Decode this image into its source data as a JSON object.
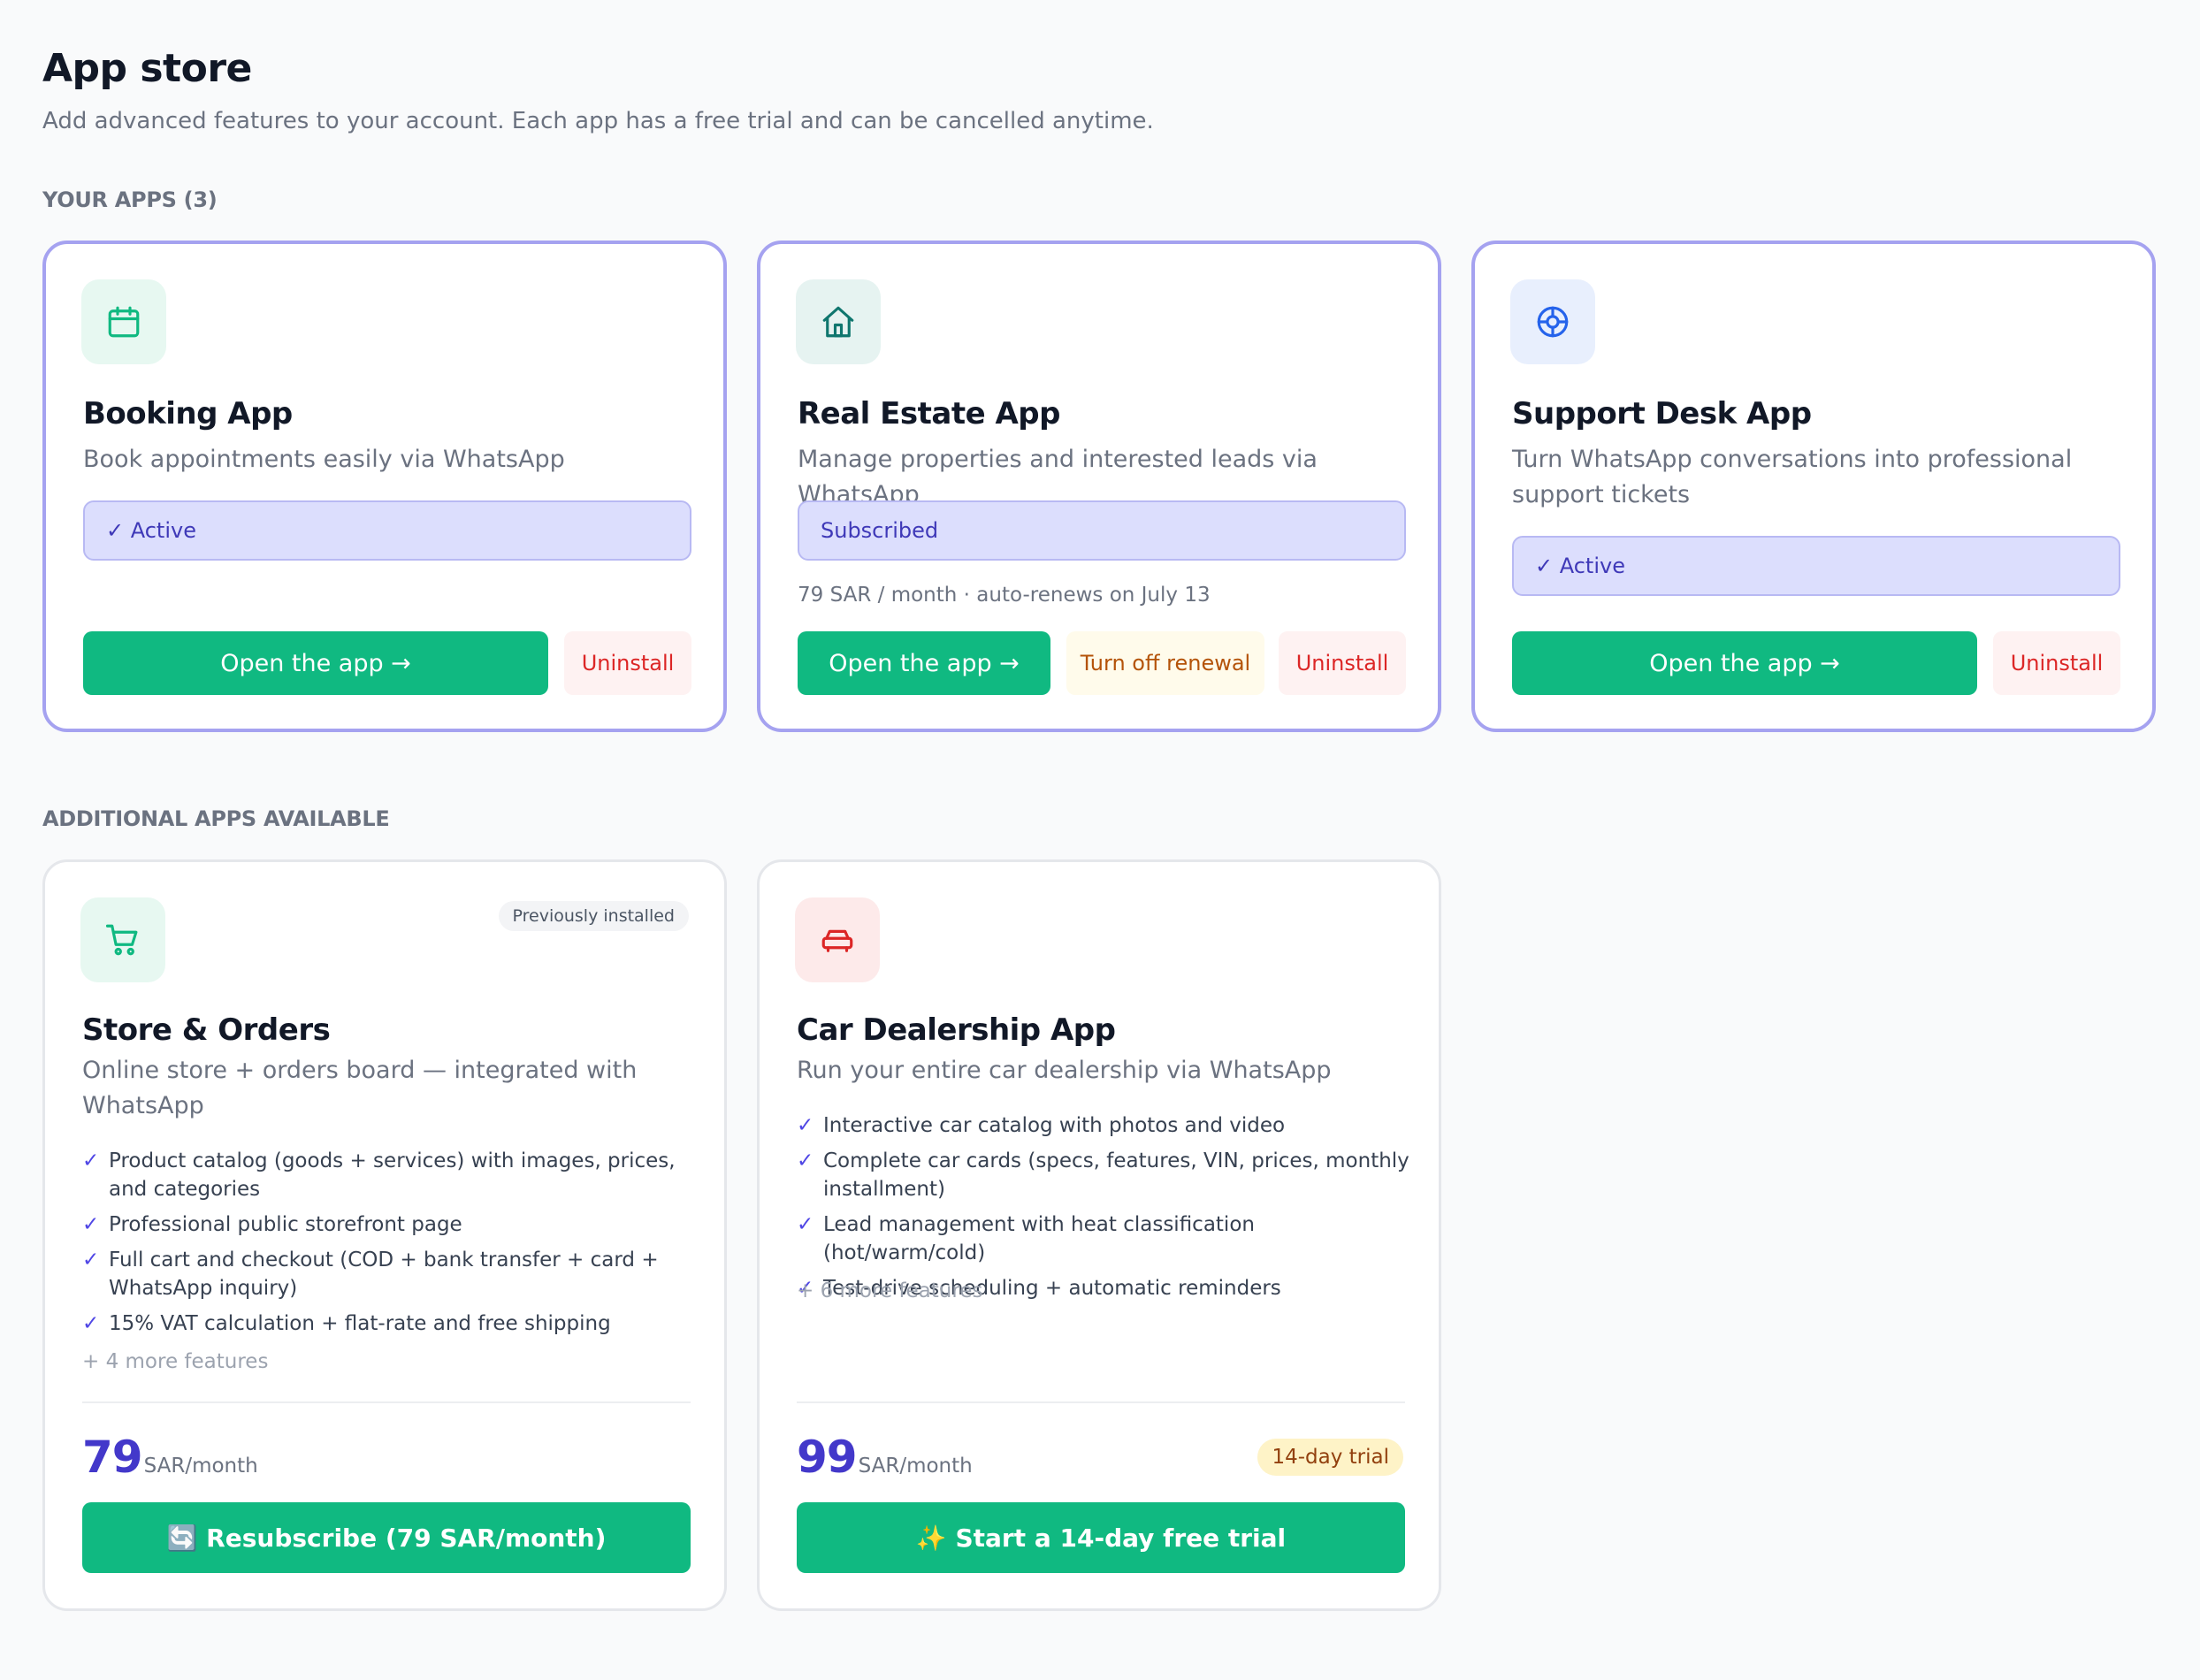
{
  "header": {
    "title": "App store",
    "subtitle": "Add advanced features to your account. Each app has a free trial and can be cancelled anytime."
  },
  "sections": {
    "your_apps": "YOUR APPS (3)",
    "available": "ADDITIONAL APPS AVAILABLE"
  },
  "your_apps": [
    {
      "title": "Booking App",
      "desc": "Book appointments easily via WhatsApp",
      "status": "✓ Active",
      "open": "Open the app →",
      "uninstall": "Uninstall",
      "icon": "calendar-icon"
    },
    {
      "title": "Real Estate App",
      "desc": "Manage properties and interested leads via WhatsApp",
      "status": "Subscribed",
      "renew_note": "79 SAR / month · auto-renews on July 13",
      "open": "Open the app →",
      "turn_off": "Turn off renewal",
      "uninstall": "Uninstall",
      "icon": "home-icon"
    },
    {
      "title": "Support Desk App",
      "desc": "Turn WhatsApp conversations into professional support tickets",
      "status": "✓ Active",
      "open": "Open the app →",
      "uninstall": "Uninstall",
      "icon": "lifebuoy-icon"
    }
  ],
  "available_apps": [
    {
      "badge": "Previously installed",
      "title": "Store & Orders",
      "desc": "Online store + orders board — integrated with WhatsApp",
      "features": [
        "Product catalog (goods + services) with images, prices, and categories",
        "Professional public storefront page",
        "Full cart and checkout (COD + bank transfer + card + WhatsApp inquiry)",
        "15% VAT calculation + flat-rate and free shipping"
      ],
      "more": "+ 4 more features",
      "price": "79",
      "unit": "SAR/month",
      "cta": "🔄 Resubscribe (79 SAR/month)",
      "icon": "cart-icon"
    },
    {
      "title": "Car Dealership App",
      "desc": "Run your entire car dealership via WhatsApp",
      "features": [
        "Interactive car catalog with photos and video",
        "Complete car cards (specs, features, VIN, prices, monthly installment)",
        "Lead management with heat classification (hot/warm/cold)",
        "Test-drive scheduling + automatic reminders"
      ],
      "more": "+ 6 more features",
      "price": "99",
      "unit": "SAR/month",
      "trial_badge": "14-day trial",
      "cta": "✨ Start a 14-day free trial",
      "icon": "car-icon"
    }
  ],
  "colors": {
    "primary": "#10b981",
    "accent": "#4338ca",
    "owned_border": "#a5a2f0",
    "danger": "#dc2626"
  },
  "check_mark": "✓"
}
